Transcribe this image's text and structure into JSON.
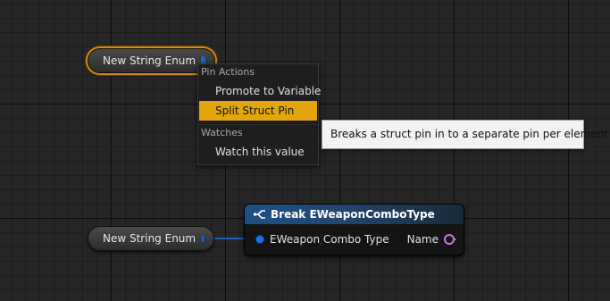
{
  "node_top": {
    "label": "New String Enum"
  },
  "context_menu": {
    "sections": [
      {
        "header": "Pin Actions",
        "items": [
          "Promote to Variable",
          "Split Struct Pin"
        ]
      },
      {
        "header": "Watches",
        "items": [
          "Watch this value"
        ]
      }
    ],
    "highlighted_item": "Split Struct Pin"
  },
  "tooltip": {
    "text": "Breaks a struct pin in to a separate pin per element"
  },
  "node_bottom": {
    "label": "New String Enum"
  },
  "break_node": {
    "title": "Break EWeaponComboType",
    "input_pin": "EWeapon Combo Type",
    "output_pin": "Name"
  },
  "colors": {
    "selection_outline": "#d48a18",
    "menu_highlight": "#e3a50c",
    "struct_pin": "#1673e0",
    "name_pin": "#c278e8",
    "break_header": "#1e4f86"
  }
}
